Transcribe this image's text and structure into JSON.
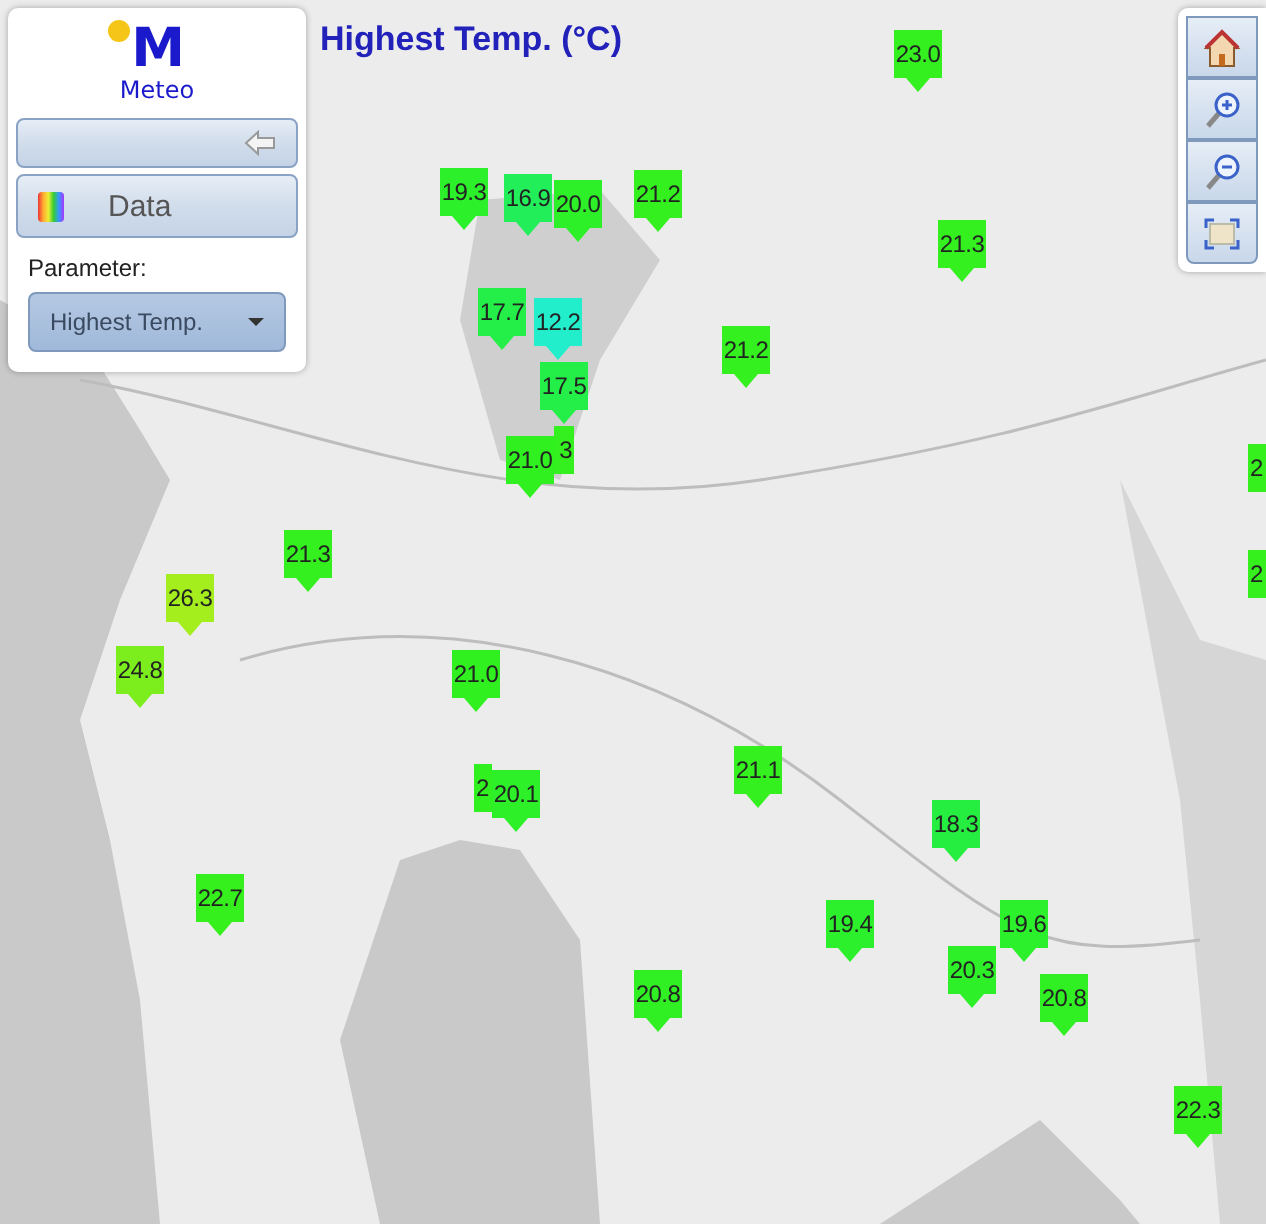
{
  "logo": {
    "mark": "M",
    "name": "Meteo"
  },
  "panel": {
    "data_button": "Data",
    "parameter_label": "Parameter:",
    "parameter_value": "Highest Temp."
  },
  "map_title": "Highest Temp. (°C)",
  "markers": [
    {
      "value": "23.0",
      "color": "#33f01e"
    },
    {
      "value": "19.3",
      "color": "#2cf02a"
    },
    {
      "value": "16.9",
      "color": "#22ee5a"
    },
    {
      "value": "20.0",
      "color": "#2ef028"
    },
    {
      "value": "21.2",
      "color": "#33f01e"
    },
    {
      "value": "21.3",
      "color": "#33f01e"
    },
    {
      "value": "17.7",
      "color": "#24ee48"
    },
    {
      "value": "12.2",
      "color": "#22eecc"
    },
    {
      "value": "17.5",
      "color": "#24ee48"
    },
    {
      "value": "21.2",
      "color": "#33f01e"
    },
    {
      "value": "3",
      "color": "#33f01e"
    },
    {
      "value": "21.0",
      "color": "#30f020"
    },
    {
      "value": "21.3",
      "color": "#33f01e"
    },
    {
      "value": "26.3",
      "color": "#a4ee1e"
    },
    {
      "value": "24.8",
      "color": "#7cee1e"
    },
    {
      "value": "21.0",
      "color": "#30f020"
    },
    {
      "value": "2",
      "color": "#30f020"
    },
    {
      "value": "20.1",
      "color": "#2ef028"
    },
    {
      "value": "21.1",
      "color": "#33f01e"
    },
    {
      "value": "18.3",
      "color": "#26ee40"
    },
    {
      "value": "19.4",
      "color": "#2cf02c"
    },
    {
      "value": "19.6",
      "color": "#2cf02c"
    },
    {
      "value": "20.3",
      "color": "#2ef028"
    },
    {
      "value": "20.8",
      "color": "#30f024"
    },
    {
      "value": "20.8",
      "color": "#30f024"
    },
    {
      "value": "22.7",
      "color": "#36f01e"
    },
    {
      "value": "22.3",
      "color": "#36f01e"
    },
    {
      "value": "2",
      "color": "#36f01e"
    },
    {
      "value": "2",
      "color": "#36f01e"
    }
  ]
}
